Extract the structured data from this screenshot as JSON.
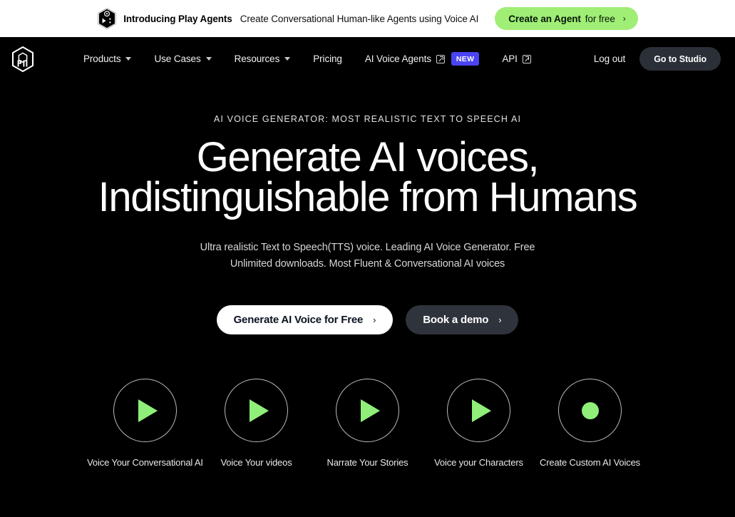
{
  "colors": {
    "page_background": "#000000",
    "banner_background": "#ffffff",
    "accent_green": "#8fef79",
    "banner_cta_green": "#a0ee75",
    "new_badge": "#4a44f2",
    "studio_button": "#2b2f38",
    "secondary_button": "#2f333c"
  },
  "banner": {
    "logo_icon": "play-cube-logo-icon",
    "title": "Introducing Play Agents",
    "subtitle": "Create Conversational Human-like Agents using Voice AI",
    "cta_strong": "Create an Agent",
    "cta_light": "for free",
    "cta_chevron": "›"
  },
  "nav": {
    "logo_icon": "playht-cube-logo-icon",
    "items": [
      {
        "label": "Products",
        "has_dropdown": true,
        "external": false,
        "badge": null
      },
      {
        "label": "Use Cases",
        "has_dropdown": true,
        "external": false,
        "badge": null
      },
      {
        "label": "Resources",
        "has_dropdown": true,
        "external": false,
        "badge": null
      },
      {
        "label": "Pricing",
        "has_dropdown": false,
        "external": false,
        "badge": null
      },
      {
        "label": "AI Voice Agents",
        "has_dropdown": false,
        "external": true,
        "badge": "NEW"
      },
      {
        "label": "API",
        "has_dropdown": false,
        "external": true,
        "badge": null
      }
    ],
    "logout_label": "Log out",
    "studio_label": "Go to Studio"
  },
  "hero": {
    "eyebrow": "AI VOICE GENERATOR: MOST REALISTIC TEXT TO SPEECH AI",
    "heading": "Generate AI voices, Indistinguishable from Humans",
    "subtitle": "Ultra realistic Text to Speech(TTS) voice. Leading AI Voice Generator. Free Unlimited downloads. Most Fluent & Conversational AI voices",
    "primary_cta": "Generate AI Voice for Free",
    "primary_cta_chevron": "›",
    "secondary_cta": "Book a demo",
    "secondary_cta_chevron": "›"
  },
  "use_cases": [
    {
      "label": "Voice Your Conversational AI",
      "icon": "play-icon"
    },
    {
      "label": "Voice Your videos",
      "icon": "play-icon"
    },
    {
      "label": "Narrate Your Stories",
      "icon": "play-icon"
    },
    {
      "label": "Voice your Characters",
      "icon": "play-icon"
    },
    {
      "label": "Create Custom AI Voices",
      "icon": "record-dot-icon"
    }
  ]
}
